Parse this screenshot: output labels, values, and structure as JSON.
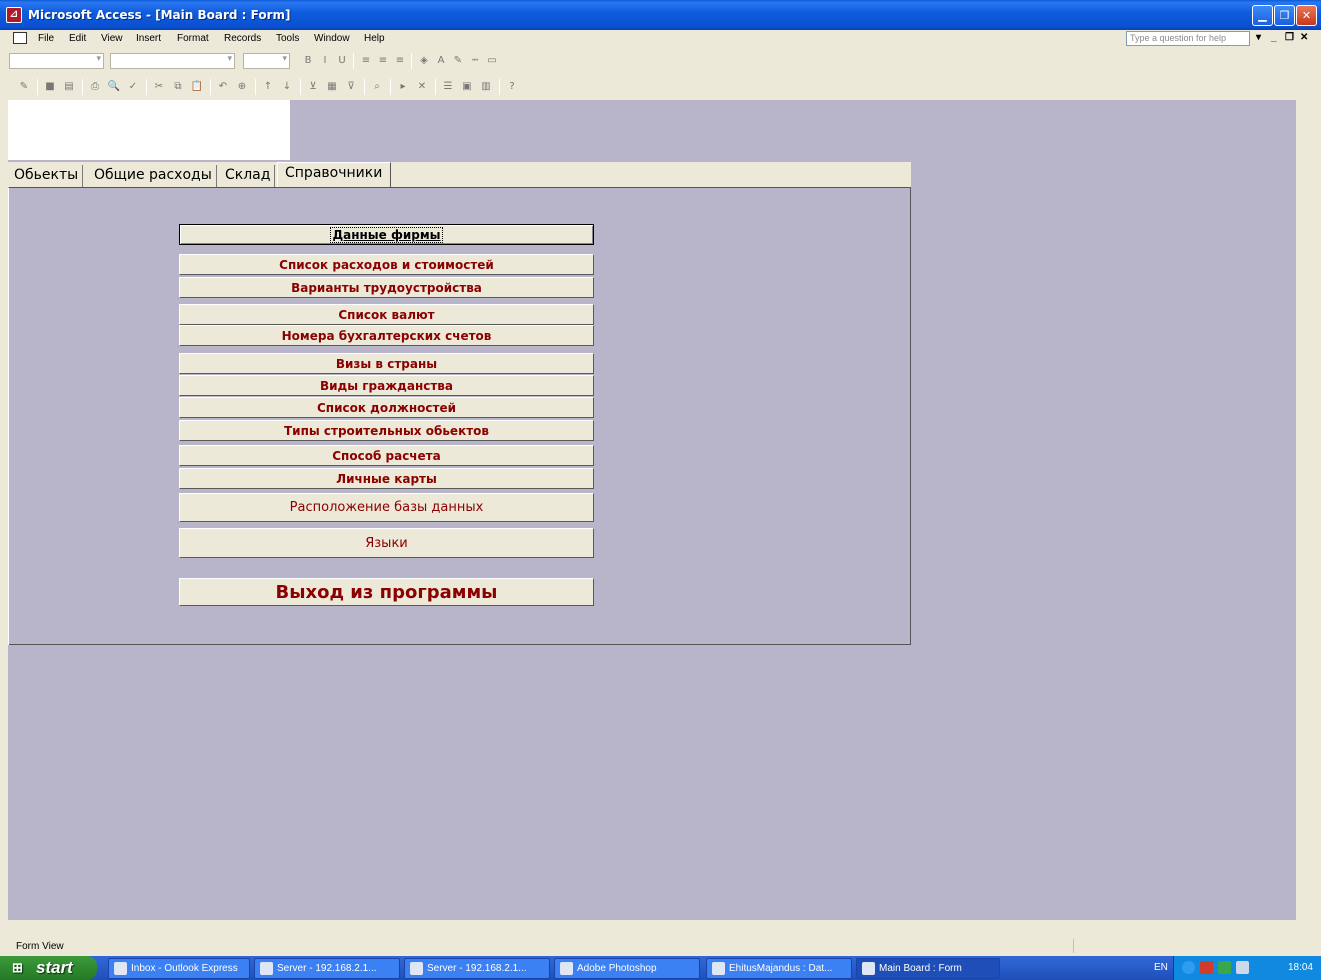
{
  "window": {
    "app_icon": "access-icon",
    "title": "Microsoft Access - [Main Board : Form]"
  },
  "menu": {
    "items": [
      "File",
      "Edit",
      "View",
      "Insert",
      "Format",
      "Records",
      "Tools",
      "Window",
      "Help"
    ],
    "help_placeholder": "Type a question for help"
  },
  "toolbar_format": {
    "icons": [
      "bold-icon",
      "italic-icon",
      "underline-icon",
      "align-left-icon",
      "align-center-icon",
      "align-right-icon",
      "fill-color-icon",
      "font-color-icon",
      "line-color-icon",
      "line-width-icon",
      "special-effect-icon"
    ],
    "glyphs": [
      "B",
      "I",
      "U",
      "≡",
      "≡",
      "≡",
      "◈",
      "A",
      "✎",
      "┉",
      "▭"
    ]
  },
  "toolbar_standard": {
    "icons": [
      "view-icon",
      "save-icon",
      "search-file-icon",
      "print-icon",
      "print-preview-icon",
      "spelling-icon",
      "cut-icon",
      "copy-icon",
      "paste-icon",
      "undo-icon",
      "hyperlink-icon",
      "sort-ascending-icon",
      "sort-descending-icon",
      "filter-selection-icon",
      "filter-form-icon",
      "apply-filter-icon",
      "find-icon",
      "new-record-icon",
      "delete-record-icon",
      "properties-icon",
      "database-window-icon",
      "new-object-icon",
      "help-icon"
    ],
    "glyphs": [
      "✎",
      "■",
      "▤",
      "⎙",
      "🔍",
      "✓",
      "✂",
      "⧉",
      "📋",
      "↶",
      "⊕",
      "↑",
      "↓",
      "⊻",
      "▦",
      "⊽",
      "⌕",
      "▸",
      "✕",
      "☰",
      "▣",
      "▥",
      "?"
    ]
  },
  "tabs": [
    {
      "label": "Обьекты",
      "active": false
    },
    {
      "label": "Общие расходы",
      "active": false
    },
    {
      "label": "Склад",
      "active": false
    },
    {
      "label": "Справочники",
      "active": true
    }
  ],
  "buttons": [
    {
      "label": "Данные фирмы",
      "style": "focused"
    },
    {
      "label": "Список расходов и стоимостей",
      "style": "normal"
    },
    {
      "label": "Варианты трудоустройства",
      "style": "normal"
    },
    {
      "label": "Список валют",
      "style": "normal"
    },
    {
      "label": "Номера бухгалтерских счетов",
      "style": "normal"
    },
    {
      "label": "Визы в страны",
      "style": "normal"
    },
    {
      "label": "Виды гражданства",
      "style": "normal"
    },
    {
      "label": "Список должностей",
      "style": "normal"
    },
    {
      "label": "Типы строительных обьектов",
      "style": "normal"
    },
    {
      "label": "Способ расчета",
      "style": "normal"
    },
    {
      "label": "Личные карты",
      "style": "normal"
    },
    {
      "label": "Расположение базы данных",
      "style": "regular"
    },
    {
      "label": "Языки",
      "style": "regular"
    },
    {
      "label": "Выход из программы",
      "style": "big"
    }
  ],
  "status": {
    "text": "Form View"
  },
  "taskbar": {
    "start_label": "start",
    "tasks": [
      {
        "label": "Inbox - Outlook Express",
        "icon": "outlook-icon",
        "active": false
      },
      {
        "label": "Server - 192.168.2.1...",
        "icon": "remote-desktop-icon",
        "active": false
      },
      {
        "label": "Server - 192.168.2.1...",
        "icon": "remote-desktop-icon",
        "active": false
      },
      {
        "label": "Adobe Photoshop",
        "icon": "photoshop-icon",
        "active": false
      },
      {
        "label": "EhitusMajandus : Dat...",
        "icon": "database-icon",
        "active": false
      },
      {
        "label": "Main Board : Form",
        "icon": "form-icon",
        "active": true
      }
    ],
    "language": "EN",
    "clock": "18:04"
  }
}
